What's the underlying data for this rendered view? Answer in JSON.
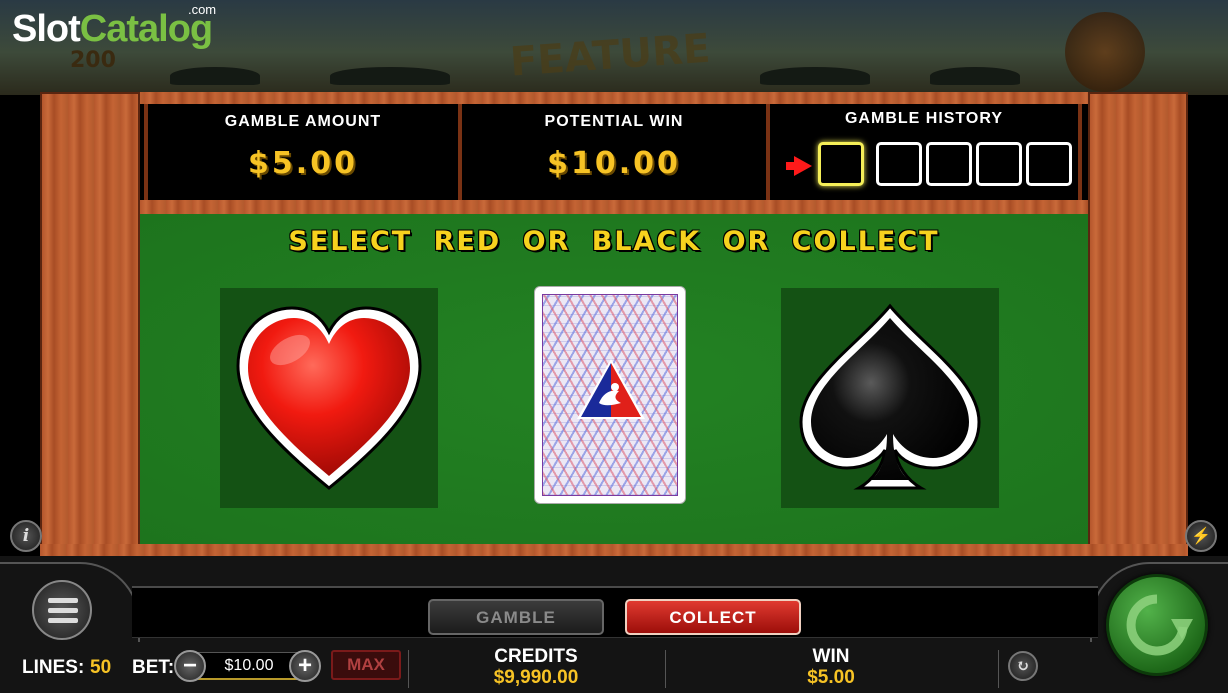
{
  "branding": {
    "logo_slot": "Slot",
    "logo_catalog": "Catalog",
    "logo_domain": ".com",
    "bg_badge": "200",
    "game_logo": "FEATURE"
  },
  "info": {
    "gamble_amount_label": "GAMBLE AMOUNT",
    "gamble_amount_value": "$5.00",
    "potential_win_label": "POTENTIAL WIN",
    "potential_win_value": "$10.00",
    "gamble_history_label": "GAMBLE HISTORY",
    "history_slots": [
      "",
      "",
      "",
      "",
      ""
    ]
  },
  "prompt": "SELECT RED OR BLACK OR COLLECT",
  "choices": {
    "red": "heart-icon",
    "card": "card-back",
    "black": "spade-icon"
  },
  "controls": {
    "info_icon": "i",
    "gamble_label": "GAMBLE",
    "collect_label": "COLLECT",
    "lines_label": "LINES:",
    "lines_value": "50",
    "bet_label": "BET:",
    "bet_value": "$10.00",
    "minus": "−",
    "plus": "+",
    "max_label": "MAX",
    "credits_label": "CREDITS",
    "credits_value": "$9,990.00",
    "win_label": "WIN",
    "win_value": "$5.00"
  },
  "colors": {
    "felt": "#1f7a1f",
    "accent_gold": "#f7c325",
    "collect_red": "#c8201a",
    "spin_green": "#3a9a32"
  }
}
